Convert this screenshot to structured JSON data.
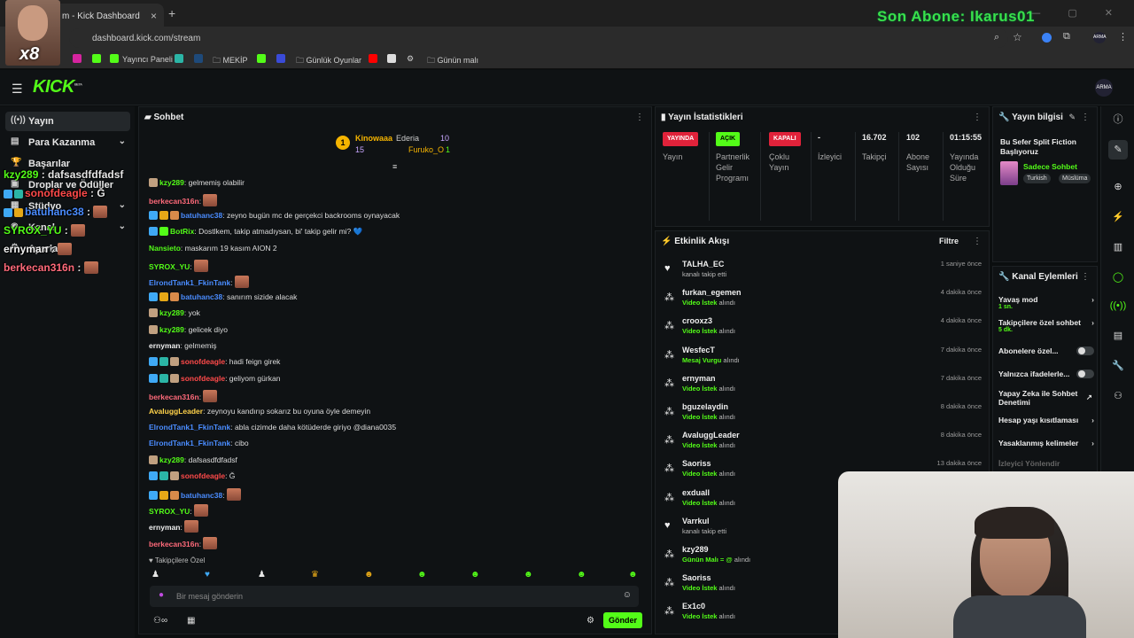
{
  "browser": {
    "tab_title": "m - Kick Dashboard",
    "url": "dashboard.kick.com/stream",
    "bookmarks": [
      "Yayıncı Paneli",
      "MEKİP",
      "Günlük Oyunlar",
      "Günün malı"
    ]
  },
  "overlay": {
    "last_sub": "Son Abone: Ikarus01",
    "cam_badge": "x8",
    "chat_lines": [
      {
        "user": "kzy289",
        "text": " : dafsasdfdfadsf",
        "color": "#53fc18"
      },
      {
        "user": "sonofdeagle",
        "text": " : Ğ",
        "color": "#ff4a4a"
      },
      {
        "user": "batuhanc38",
        "text": " : ",
        "color": "#4a8cff"
      },
      {
        "user": "SYROX_YU",
        "text": " : ",
        "color": "#53fc18"
      },
      {
        "user": "ernyman",
        "text": " : ",
        "color": "#f0f0f0"
      },
      {
        "user": "berkecan316n",
        "text": " : ",
        "color": "#ff6a7a"
      }
    ]
  },
  "header": {
    "logo": "KICK",
    "beta": "BETA",
    "avatar_text": "ARMA"
  },
  "sidebar": {
    "items": [
      {
        "label": "Yayın",
        "icon": "broadcast-icon"
      },
      {
        "label": "Para Kazanma",
        "icon": "money-icon"
      },
      {
        "label": "Başarılar",
        "icon": "trophy-icon"
      },
      {
        "label": "Droplar ve Ödüller",
        "icon": "gift-icon"
      },
      {
        "label": "Stüdyo",
        "icon": "studio-icon"
      },
      {
        "label": "Kanal",
        "icon": "channel-icon"
      },
      {
        "label": "Ayarlar",
        "icon": "gear-icon"
      }
    ]
  },
  "chat": {
    "title": "Sohbet",
    "leaders": {
      "first": {
        "name": "Kinowaaa",
        "count": "15"
      },
      "second": {
        "name": "Ederia",
        "count": "10"
      },
      "third": {
        "name": "Furuko_O",
        "count": "1"
      }
    },
    "messages": [
      {
        "user": "kzy289",
        "color": "#53fc18",
        "text": ": gelmemiş olabilir"
      },
      {
        "user": "berkecan316n",
        "color": "#ff6a7a",
        "text": ":"
      },
      {
        "user": "batuhanc38",
        "color": "#4a8cff",
        "text": ": zeyno bugün mc de gerçekci backrooms oynayacak"
      },
      {
        "user": "BotRix",
        "color": "#53fc18",
        "text": ": Dostlkem, takip atmadıysan, bi' takip gelir mi? 💙"
      },
      {
        "user": "Nansieto",
        "color": "#53fc18",
        "text": ": maskarım 19 kasım AION 2"
      },
      {
        "user": "SYROX_YU",
        "color": "#53fc18",
        "text": ":"
      },
      {
        "user": "ElrondTank1_FkinTank",
        "color": "#4a8cff",
        "text": ":"
      },
      {
        "user": "batuhanc38",
        "color": "#4a8cff",
        "text": ": sanırım sizide alacak"
      },
      {
        "user": "kzy289",
        "color": "#53fc18",
        "text": ": yok"
      },
      {
        "user": "kzy289",
        "color": "#53fc18",
        "text": ": gelicek diyo"
      },
      {
        "user": "ernyman",
        "color": "#f0f0f0",
        "text": ": gelmemiş"
      },
      {
        "user": "sonofdeagle",
        "color": "#ff4a4a",
        "text": ": hadi feign girek"
      },
      {
        "user": "sonofdeagle",
        "color": "#ff4a4a",
        "text": ": geliyom gürkan"
      },
      {
        "user": "berkecan316n",
        "color": "#ff6a7a",
        "text": ":"
      },
      {
        "user": "AvaluggLeader",
        "color": "#ffd24a",
        "text": ": zeynoyu kandırıp sokarız bu oyuna öyle demeyin"
      },
      {
        "user": "ElrondTank1_FkinTank",
        "color": "#4a8cff",
        "text": ": abla cizimde daha kötüderde giriyo @diana0035"
      },
      {
        "user": "ElrondTank1_FkinTank",
        "color": "#4a8cff",
        "text": ": cibo"
      },
      {
        "user": "kzy289",
        "color": "#53fc18",
        "text": ": dafsasdfdfadsf"
      },
      {
        "user": "sonofdeagle",
        "color": "#ff4a4a",
        "text": ": Ğ"
      },
      {
        "user": "batuhanc38",
        "color": "#4a8cff",
        "text": ":"
      },
      {
        "user": "SYROX_YU",
        "color": "#53fc18",
        "text": ":"
      },
      {
        "user": "ernyman",
        "color": "#f0f0f0",
        "text": ":"
      },
      {
        "user": "berkecan316n",
        "color": "#ff6a7a",
        "text": ":"
      }
    ],
    "followers_label": "Takipçilere Özel",
    "input_placeholder": "Bir mesaj gönderin",
    "send_label": "Gönder"
  },
  "stats": {
    "title": "Yayın İstatistikleri",
    "cols": [
      {
        "pill": "YAYINDA",
        "pill_color": "#e0223a",
        "label": "Yayın"
      },
      {
        "pill": "AÇIK",
        "pill_color": "#53fc18",
        "label": "Partnerlik Gelir Programı"
      },
      {
        "pill": "KAPALI",
        "pill_color": "#e0223a",
        "label": "Çoklu Yayın"
      },
      {
        "value": "-",
        "label": "İzleyici"
      },
      {
        "value": "16.702",
        "label": "Takipçi"
      },
      {
        "value": "102",
        "label": "Abone Sayısı"
      },
      {
        "value": "01:15:55",
        "label": "Yayında Olduğu Süre"
      }
    ]
  },
  "activity": {
    "title": "Etkinlik Akışı",
    "filter": "Filtre",
    "items": [
      {
        "name": "TALHA_EC",
        "sub": "kanalı takip etti",
        "tag": "",
        "time": "1 saniye önce",
        "icon": "heart-icon"
      },
      {
        "name": "furkan_egemen",
        "sub": " alındı",
        "tag": "Video İstek",
        "time": "4 dakika önce",
        "icon": "coins-icon"
      },
      {
        "name": "crooxz3",
        "sub": " alındı",
        "tag": "Video İstek",
        "time": "4 dakika önce",
        "icon": "coins-icon"
      },
      {
        "name": "WesfecT",
        "sub": " alındı",
        "tag": "Mesaj Vurgu",
        "time": "7 dakika önce",
        "icon": "coins-icon"
      },
      {
        "name": "ernyman",
        "sub": " alındı",
        "tag": "Video İstek",
        "time": "7 dakika önce",
        "icon": "coins-icon"
      },
      {
        "name": "bguzelaydin",
        "sub": " alındı",
        "tag": "Video İstek",
        "time": "8 dakika önce",
        "icon": "coins-icon"
      },
      {
        "name": "AvaluggLeader",
        "sub": " alındı",
        "tag": "Video İstek",
        "time": "8 dakika önce",
        "icon": "coins-icon"
      },
      {
        "name": "Saoriss",
        "sub": " alındı",
        "tag": "Video İstek",
        "time": "13 dakika önce",
        "icon": "coins-icon"
      },
      {
        "name": "exduall",
        "sub": " alındı",
        "tag": "Video İstek",
        "time": "",
        "icon": "coins-icon"
      },
      {
        "name": "Varrkul",
        "sub": "kanalı takip etti",
        "tag": "",
        "time": "",
        "icon": "heart-icon"
      },
      {
        "name": "kzy289",
        "sub": " alındı",
        "tag": "Günün Malı = @",
        "time": "",
        "icon": "coins-icon"
      },
      {
        "name": "Saoriss",
        "sub": " alındı",
        "tag": "Video İstek",
        "time": "",
        "icon": "coins-icon"
      },
      {
        "name": "Ex1c0",
        "sub": " alındı",
        "tag": "Video İstek",
        "time": "",
        "icon": "coins-icon"
      }
    ]
  },
  "stream_info": {
    "title": "Yayın bilgisi",
    "stream_title": "Bu Sefer Split Fiction Başlıyoruz",
    "category": "Sadece Sohbet",
    "tags": [
      "Turkish",
      "Müslüma"
    ]
  },
  "channel_actions": {
    "title": "Kanal Eylemleri",
    "items": [
      {
        "label": "Yavaş mod",
        "sub": "1 sn.",
        "control": "chevron"
      },
      {
        "label": "Takipçilere özel sohbet",
        "sub": "5 dk.",
        "control": "chevron"
      },
      {
        "label": "Abonelere özel...",
        "sub": "",
        "control": "toggle"
      },
      {
        "label": "Yalnızca ifadelerle...",
        "sub": "",
        "control": "toggle"
      },
      {
        "label": "Yapay Zeka ile Sohbet Denetimi",
        "sub": "",
        "control": "external"
      },
      {
        "label": "Hesap yaşı kısıtlaması",
        "sub": "",
        "control": "chevron"
      },
      {
        "label": "Yasaklanmış kelimeler",
        "sub": "",
        "control": "chevron"
      },
      {
        "label": "İzleyici Yönlendir",
        "sub": "",
        "control": "none"
      }
    ]
  }
}
